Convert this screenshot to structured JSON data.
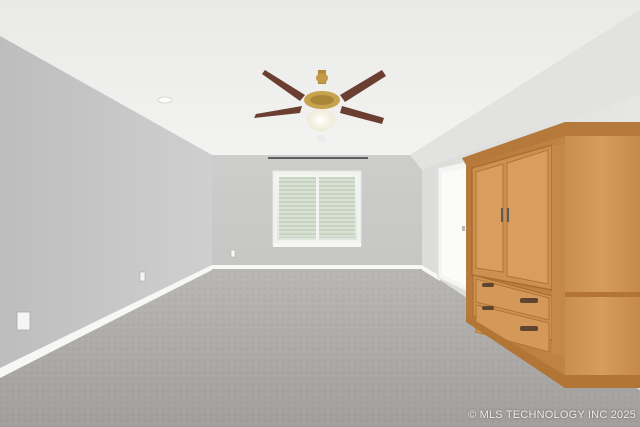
{
  "photo": {
    "watermark": "© MLS TECHNOLOGY INC 2025"
  }
}
